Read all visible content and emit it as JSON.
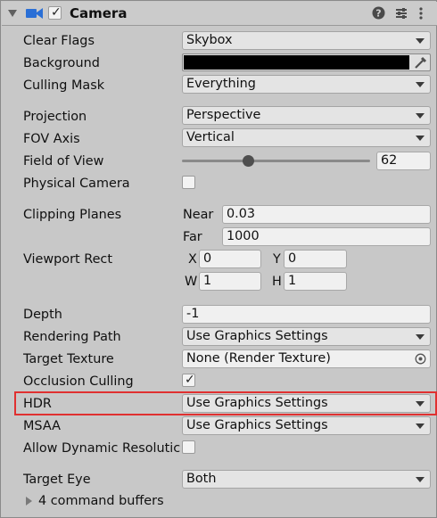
{
  "header": {
    "title": "Camera",
    "enabled": true
  },
  "fields": {
    "clear_flags": {
      "label": "Clear Flags",
      "value": "Skybox"
    },
    "background": {
      "label": "Background",
      "color": "#000000"
    },
    "culling_mask": {
      "label": "Culling Mask",
      "value": "Everything"
    },
    "projection": {
      "label": "Projection",
      "value": "Perspective"
    },
    "fov_axis": {
      "label": "FOV Axis",
      "value": "Vertical"
    },
    "field_of_view": {
      "label": "Field of View",
      "value": "62"
    },
    "physical_camera": {
      "label": "Physical Camera",
      "checked": false
    },
    "clipping_planes": {
      "label": "Clipping Planes",
      "near_label": "Near",
      "near_value": "0.03",
      "far_label": "Far",
      "far_value": "1000"
    },
    "viewport_rect": {
      "label": "Viewport Rect",
      "x_label": "X",
      "x_value": "0",
      "y_label": "Y",
      "y_value": "0",
      "w_label": "W",
      "w_value": "1",
      "h_label": "H",
      "h_value": "1"
    },
    "depth": {
      "label": "Depth",
      "value": "-1"
    },
    "rendering_path": {
      "label": "Rendering Path",
      "value": "Use Graphics Settings"
    },
    "target_texture": {
      "label": "Target Texture",
      "value": "None (Render Texture)"
    },
    "occlusion_culling": {
      "label": "Occlusion Culling",
      "checked": true
    },
    "hdr": {
      "label": "HDR",
      "value": "Use Graphics Settings"
    },
    "msaa": {
      "label": "MSAA",
      "value": "Use Graphics Settings"
    },
    "allow_dynamic_resolution": {
      "label": "Allow Dynamic Resolutic",
      "checked": false
    },
    "target_eye": {
      "label": "Target Eye",
      "value": "Both"
    }
  },
  "command_buffers": {
    "label": "4 command buffers"
  },
  "colors": {
    "highlight": "#e03030",
    "camera_icon": "#2a6fd6"
  }
}
